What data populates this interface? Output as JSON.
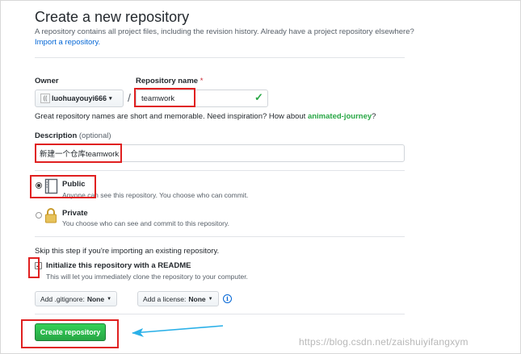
{
  "header": {
    "title": "Create a new repository",
    "subtitle": "A repository contains all project files, including the revision history. Already have a project repository elsewhere?",
    "import_link": "Import a repository."
  },
  "owner": {
    "label": "Owner",
    "value": "luohuayouyi666",
    "avatar_alt": "(("
  },
  "repo_name": {
    "label": "Repository name",
    "required_mark": "*",
    "value": "teamwork"
  },
  "separator": "/",
  "name_hint": {
    "text": "Great repository names are short and memorable. Need inspiration? How about",
    "suggestion": "animated-journey",
    "end": "?"
  },
  "description": {
    "label": "Description",
    "optional": "(optional)",
    "value": "新建一个仓库teamwork"
  },
  "visibility": {
    "public": {
      "title": "Public",
      "desc": "Anyone can see this repository. You choose who can commit.",
      "selected": true
    },
    "private": {
      "title": "Private",
      "desc": "You choose who can see and commit to this repository.",
      "selected": false
    }
  },
  "init": {
    "skip_note": "Skip this step if you're importing an existing repository.",
    "readme_label": "Initialize this repository with a README",
    "readme_checked": true,
    "readme_desc": "This will let you immediately clone the repository to your computer."
  },
  "dropdowns": {
    "gitignore_label": "Add .gitignore:",
    "gitignore_value": "None",
    "license_label": "Add a license:",
    "license_value": "None"
  },
  "create_button": "Create repository",
  "watermark": "https://blog.csdn.net/zaishuiyifangxym",
  "colors": {
    "annotation_red": "#e02020",
    "arrow_cyan": "#2ab0e8",
    "create_green": "#28a745",
    "link_blue": "#0366d6"
  }
}
